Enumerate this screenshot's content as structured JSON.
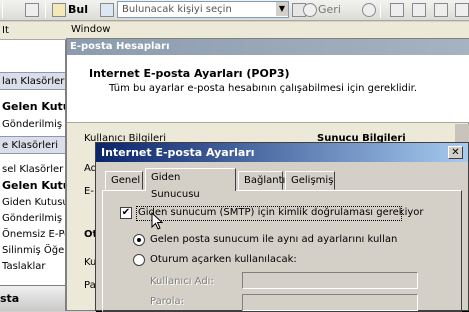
{
  "toolbar": {
    "find_label": "Bul",
    "contact_placeholder": "Bulunacak kişiyi seçin",
    "back_label": "Geri"
  },
  "strip2": {
    "it": "It",
    "window_label": "Window"
  },
  "left_pane": {
    "items": [
      {
        "label": "lan Klasörler",
        "style": "header"
      },
      {
        "label": "Gelen Kutusu",
        "style": "bold"
      },
      {
        "label": "Gönderilmiş Öğel",
        "style": "normal"
      },
      {
        "label": "e Klasörleri",
        "style": "header"
      },
      {
        "label": "sel Klasörler",
        "style": "normal"
      },
      {
        "label": "Gelen Kutu",
        "style": "bold"
      },
      {
        "label": "Giden Kutusu",
        "style": "normal"
      },
      {
        "label": "Gönderilmiş Ö",
        "style": "normal"
      },
      {
        "label": "Önemsiz E-Po",
        "style": "normal"
      },
      {
        "label": "Silinmiş Öğele",
        "style": "normal"
      },
      {
        "label": "Taslaklar",
        "style": "normal"
      }
    ],
    "bottom_label": "sta"
  },
  "accounts_window": {
    "title": "E-posta Hesapları",
    "header_title": "Internet E-posta Ayarları (POP3)",
    "header_subtitle": "Tüm bu ayarlar e-posta hesabının çalışabilmesi için gereklidir.",
    "user_info": "Kullanıcı Bilgileri",
    "server_info": "Sunucu Bilgileri",
    "frag_ad": "Ad",
    "frag_e": "E-",
    "frag_ot": "Ot",
    "frag_ku": "Ku",
    "frag_pa": "Pa"
  },
  "dialog": {
    "title": "Internet E-posta Ayarları",
    "close_symbol": "✕",
    "tabs": [
      "Genel",
      "Giden Sunucusu",
      "Bağlantı",
      "Gelişmiş"
    ],
    "active_tab": 1,
    "auth_checkbox_label": "Giden sunucum (SMTP) için kimlik doğrulaması gerekiyor",
    "auth_checked": true,
    "check_mark": "✔",
    "radio_same": "Gelen posta sunucum ile aynı ad ayarlarını kullan",
    "radio_logon": "Oturum açarken kullanılacak:",
    "username_label": "Kullanıcı Adı:",
    "password_label": "Parola:"
  }
}
